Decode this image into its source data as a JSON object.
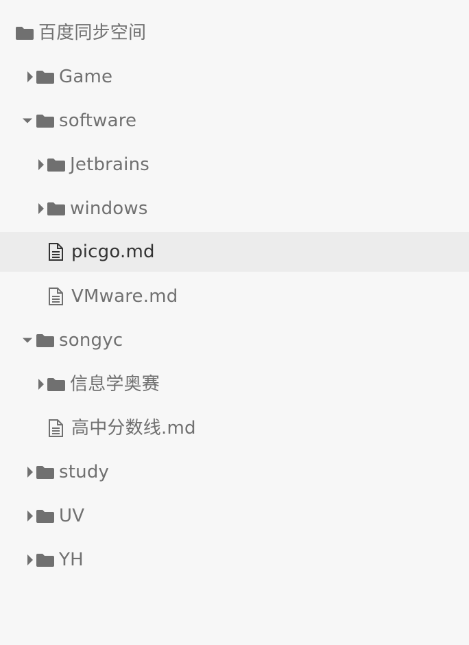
{
  "colors": {
    "background": "#f7f7f7",
    "active_row": "#ececec",
    "text": "#707070",
    "active_text": "#333333",
    "icon": "#707070"
  },
  "tree": {
    "root": {
      "label": "百度同步空间",
      "icon": "folder-icon"
    },
    "items": [
      {
        "label": "Game",
        "type": "folder",
        "state": "collapsed"
      },
      {
        "label": "software",
        "type": "folder",
        "state": "expanded"
      },
      {
        "label": "Jetbrains",
        "type": "folder",
        "state": "collapsed"
      },
      {
        "label": "windows",
        "type": "folder",
        "state": "collapsed"
      },
      {
        "label": "picgo.md",
        "type": "file",
        "selected": true
      },
      {
        "label": "VMware.md",
        "type": "file"
      },
      {
        "label": "songyc",
        "type": "folder",
        "state": "expanded"
      },
      {
        "label": "信息学奥赛",
        "type": "folder",
        "state": "collapsed"
      },
      {
        "label": "高中分数线.md",
        "type": "file"
      },
      {
        "label": "study",
        "type": "folder",
        "state": "collapsed"
      },
      {
        "label": "UV",
        "type": "folder",
        "state": "collapsed"
      },
      {
        "label": "YH",
        "type": "folder",
        "state": "collapsed"
      }
    ]
  }
}
